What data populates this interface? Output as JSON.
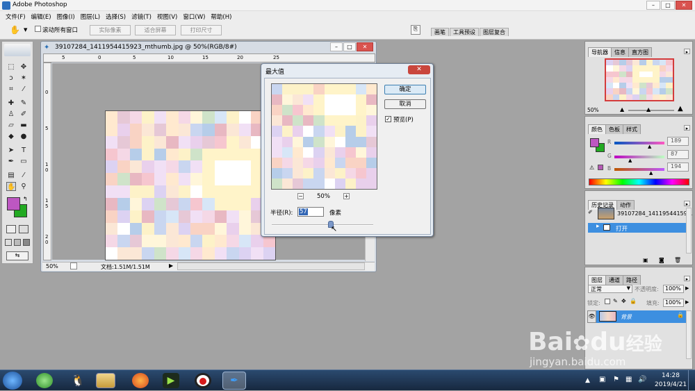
{
  "app": {
    "title": "Adobe Photoshop"
  },
  "menu": [
    "文件(F)",
    "编辑(E)",
    "图像(I)",
    "图层(L)",
    "选择(S)",
    "滤镜(T)",
    "视图(V)",
    "窗口(W)",
    "帮助(H)"
  ],
  "options": {
    "scroll_all_windows": "滚动所有窗口",
    "actual_pixels": "实际像素",
    "fit_screen": "适合屏幕",
    "print_size": "打印尺寸",
    "well_tabs": [
      "画笔",
      "工具预设",
      "图层复合"
    ]
  },
  "document": {
    "title": "39107284_1411954415923_mthumb.jpg @ 50%(RGB/8#)",
    "zoom": "50%",
    "doc_size": "文档:1.51M/1.51M",
    "ruler_h_labels": [
      "5",
      "0",
      "5",
      "10",
      "15",
      "20",
      "25"
    ],
    "ruler_v_labels": [
      "0",
      "5",
      "1\n0",
      "1\n5",
      "2\n0"
    ]
  },
  "dialog": {
    "title": "最大值",
    "ok": "确定",
    "cancel": "取消",
    "preview_label": "预览(P)",
    "zoom": "50%",
    "radius_label": "半径(R):",
    "radius_value": "57",
    "radius_unit": "像素"
  },
  "navigator": {
    "tabs": [
      "导航器",
      "信息",
      "直方图"
    ],
    "zoom": "50%"
  },
  "color_panel": {
    "tabs": [
      "颜色",
      "色板",
      "样式"
    ],
    "r_label": "R",
    "g_label": "G",
    "b_label": "B",
    "r": "189",
    "g": "87",
    "b": "194",
    "foreground": "#bd57c2",
    "background": "#22aa22"
  },
  "history": {
    "tabs": [
      "历史记录",
      "动作"
    ],
    "snapshot": "39107284_14119544159...",
    "step": "打开"
  },
  "layers": {
    "tabs": [
      "图层",
      "通道",
      "路径"
    ],
    "blend_mode": "正常",
    "opacity_label": "不透明度:",
    "opacity": "100%",
    "lock_label": "锁定:",
    "fill_label": "填充:",
    "fill": "100%",
    "layer_name": "背景"
  },
  "taskbar": {
    "time": "14:28",
    "date": "2019/4/21"
  },
  "watermark": {
    "brand": "Bai",
    "brand2": "du",
    "text": "经验",
    "url": "jingyan.baidu.com"
  }
}
